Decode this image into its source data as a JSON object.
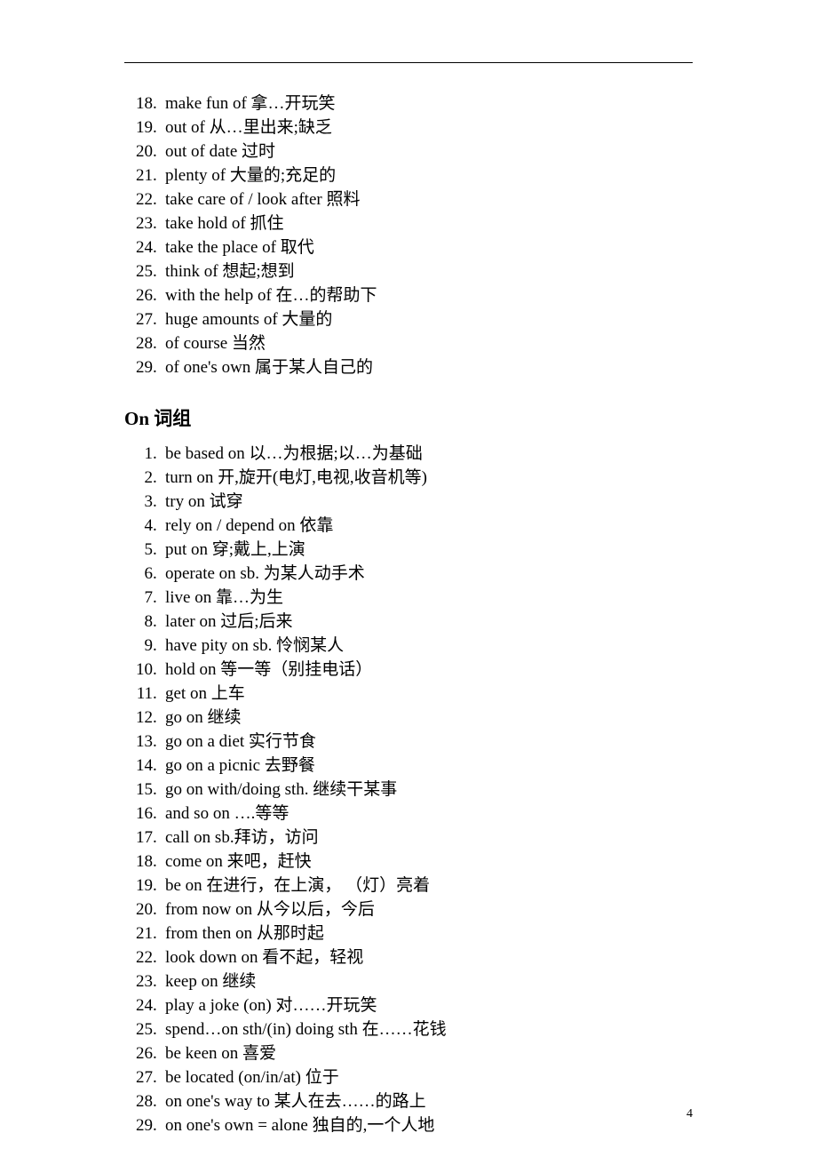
{
  "page_number": "4",
  "section1": {
    "start": 18,
    "items": [
      "make fun of  拿…开玩笑",
      "out of  从…里出来;缺乏",
      "out of date  过时",
      "plenty of  大量的;充足的",
      "take care of / look after  照料",
      "take hold of  抓住",
      "take the place of  取代",
      "think of  想起;想到",
      "with the help of  在…的帮助下",
      "huge amounts of  大量的",
      "of course 当然",
      "of one's own 属于某人自己的"
    ]
  },
  "heading_on": "On 词组",
  "section2": {
    "start": 1,
    "items": [
      "be based on 以…为根据;以…为基础",
      "turn on  开,旋开(电灯,电视,收音机等)",
      "try on  试穿",
      "rely on / depend on  依靠",
      "put on  穿;戴上,上演",
      "operate on sb.  为某人动手术",
      "live on  靠…为生",
      "later on  过后;后来",
      "have pity on sb.  怜悯某人",
      "hold on 等一等（别挂电话）",
      "get on  上车",
      "go on  继续",
      "go on a diet 实行节食",
      "go on a picnic  去野餐",
      "go on with/doing sth.  继续干某事",
      "and so on         ….等等",
      "call on sb.拜访，访问",
      "come on  来吧，赶快",
      "be on   在进行，在上演，  （灯）亮着",
      "from now on  从今以后，今后",
      "from then on 从那时起",
      "look down on 看不起，轻视",
      "keep on 继续",
      "play a joke (on)  对……开玩笑",
      "spend…on sth/(in) doing sth 在……花钱",
      "be keen on 喜爱",
      "be located (on/in/at)  位于",
      "on one's way to  某人在去……的路上",
      "on one's own = alone  独自的,一个人地"
    ]
  }
}
